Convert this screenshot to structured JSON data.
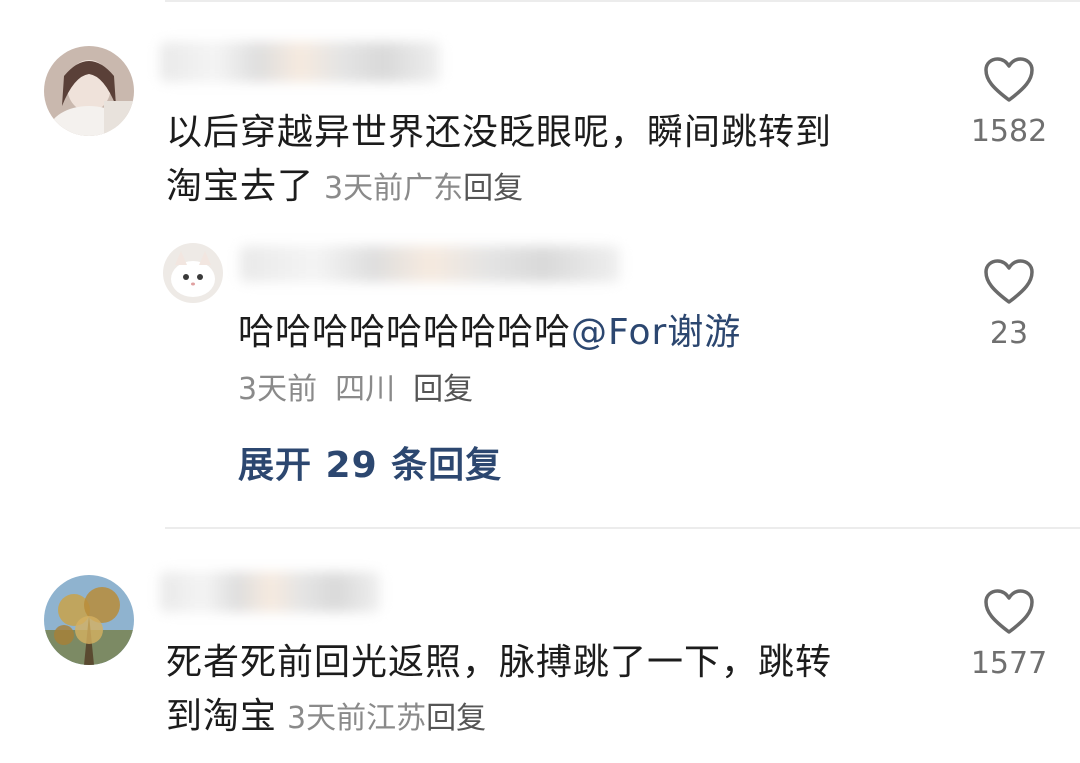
{
  "comments": [
    {
      "text_line1": "以后穿越异世界还没眨眼呢，瞬间跳转到",
      "text_line2": "淘宝去了",
      "time": "3天前",
      "location": "广东",
      "reply_label": "回复",
      "likes": "1582",
      "reply": {
        "text_prefix": "哈哈哈哈哈哈哈哈哈",
        "mention": "@For谢游",
        "time": "3天前",
        "location": "四川",
        "reply_label": "回复",
        "likes": "23"
      },
      "expand_label": "展开 29 条回复"
    },
    {
      "text_line1": "死者死前回光返照，脉搏跳了一下，跳转",
      "text_line2": "到淘宝",
      "time": "3天前",
      "location": "江苏",
      "reply_label": "回复",
      "likes": "1577"
    }
  ],
  "icons": {
    "like": "heart-outline-icon"
  },
  "colors": {
    "text": "#1c1c1c",
    "meta": "#8a8a8a",
    "link": "#2c4770",
    "divider": "#ececec"
  }
}
